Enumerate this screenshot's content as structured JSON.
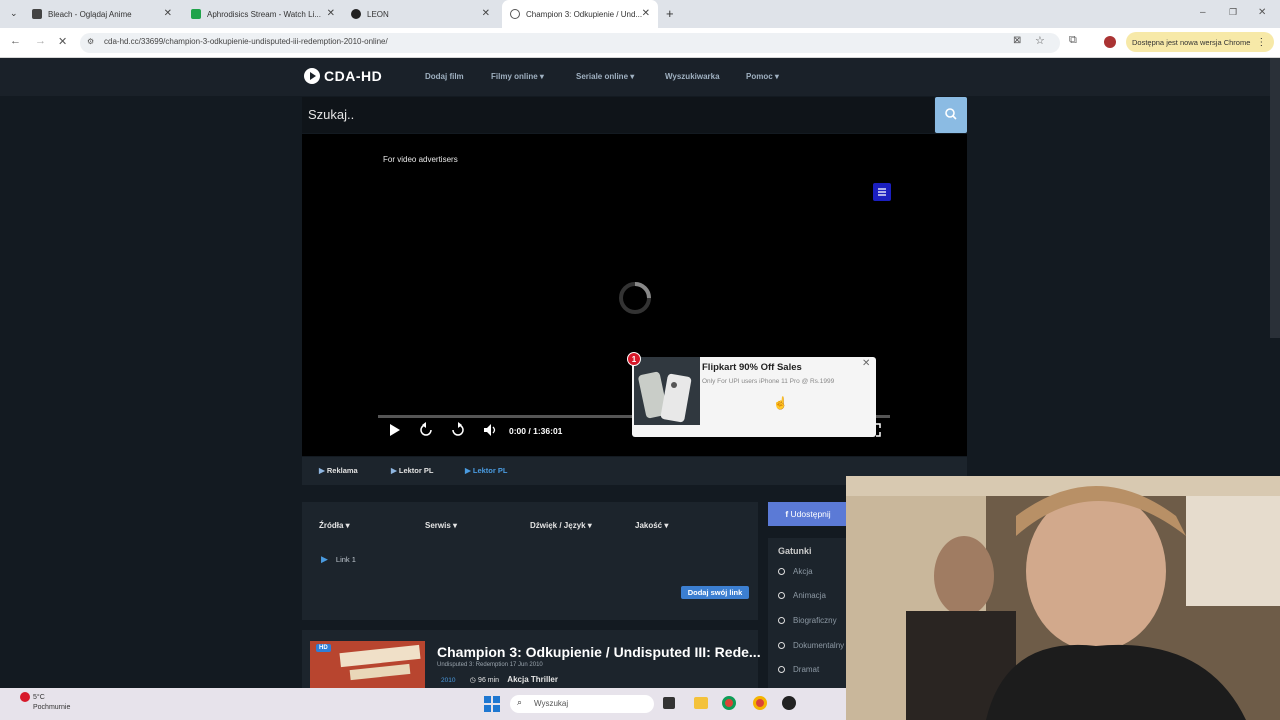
{
  "browser": {
    "tabs": [
      {
        "label": "Bleach - Oglądaj Anime",
        "active": false
      },
      {
        "label": "Aphrodisics Stream - Watch Li...",
        "active": false
      },
      {
        "label": "LEON",
        "active": false
      },
      {
        "label": "Champion 3: Odkupienie / Und...",
        "active": true
      }
    ],
    "url": "cda-hd.cc/33699/champion-3-odkupienie-undisputed-iii-redemption-2010-online/",
    "update_pill": "Dostępna jest nowa wersja Chrome"
  },
  "site": {
    "logo": "CDA-HD",
    "nav": [
      "Dodaj film",
      "Filmy online ▾",
      "Seriale online ▾",
      "Wyszukiwarka",
      "Pomoc ▾"
    ],
    "search_placeholder": "Szukaj..",
    "player": {
      "ad_label": "For video advertisers",
      "time": "0:00 / 1:36:01",
      "progress": 0
    },
    "ad": {
      "badge": "1",
      "title": "Flipkart 90% Off Sales",
      "text": "Only For UPI users iPhone 11 Pro @ Rs.1999"
    },
    "source_tabs": [
      "Reklama",
      "Lektor PL",
      "Lektor PL"
    ],
    "links_table": {
      "headers": [
        "Źródła ▾",
        "Serwis ▾",
        "Dźwięk / Język ▾",
        "Jakość ▾"
      ],
      "rows": [
        "Link 1"
      ],
      "add_button": "Dodaj swój link"
    },
    "movie": {
      "badge": "HD",
      "title": "Champion 3: Odkupienie / Undisputed III: Rede...",
      "subtitle": "Undisputed 3: Redemption   17 Jun 2010",
      "year": "2010",
      "duration": "96 min",
      "genres": "Akcja  Thriller"
    },
    "share_button": "Udostępnij",
    "genres_title": "Gatunki",
    "genres": [
      "Akcja",
      "Animacja",
      "Biograficzny",
      "Dokumentalny",
      "Dramat"
    ]
  },
  "taskbar": {
    "weather_temp": "5°C",
    "weather_desc": "Pochmurnie",
    "search": "Wyszukaj"
  },
  "colors": {
    "page_bg": "#131a21",
    "panel_bg": "#1c242c",
    "accent_blue": "#3c7fd1",
    "ad_red": "#d7192a"
  }
}
